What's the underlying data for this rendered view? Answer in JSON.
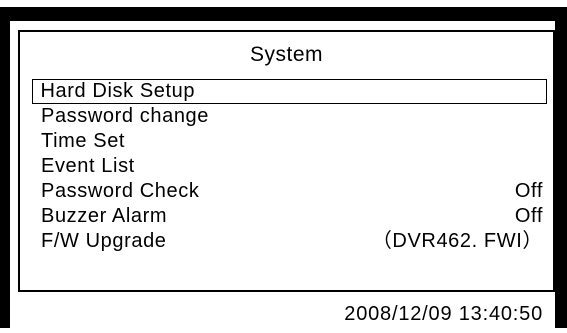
{
  "system": {
    "title": "System"
  },
  "menu": {
    "items": [
      {
        "label": "Hard Disk Setup",
        "value": ""
      },
      {
        "label": "Password change",
        "value": ""
      },
      {
        "label": "Time Set",
        "value": ""
      },
      {
        "label": "Event List",
        "value": ""
      },
      {
        "label": "Password Check",
        "value": "Off"
      },
      {
        "label": "Buzzer Alarm",
        "value": "Off"
      },
      {
        "label": "F/W Upgrade",
        "value": "（DVR462. FWI）"
      }
    ],
    "selected_index": 0
  },
  "status": {
    "datetime": "2008/12/09  13:40:50"
  },
  "colors": {
    "background": "#ffffff",
    "frame": "#000000",
    "text": "#000000"
  }
}
